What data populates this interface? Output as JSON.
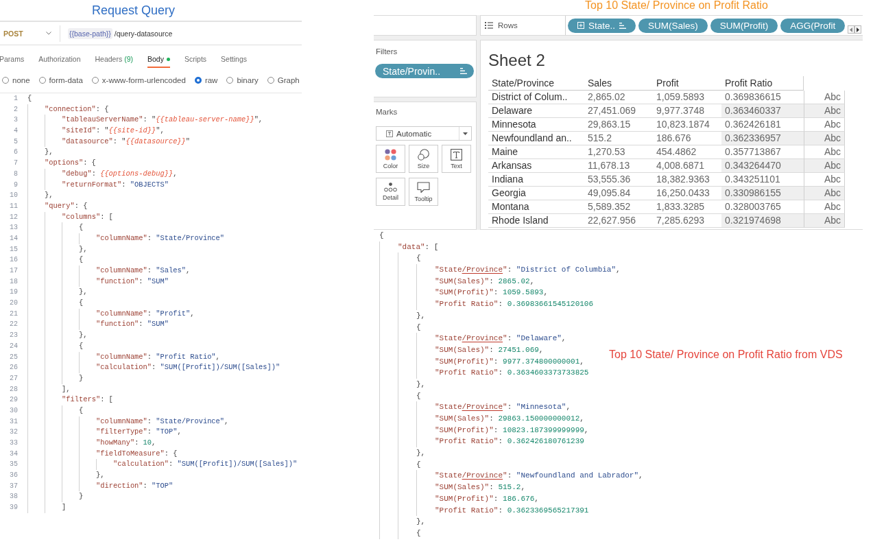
{
  "request": {
    "title": "Request Query",
    "method": "POST",
    "url": {
      "variable": "{{base-path}}",
      "path": "/query-datasource"
    },
    "tabs": [
      {
        "label": "Params",
        "selected": false,
        "has_content": false
      },
      {
        "label": "Authorization",
        "selected": false,
        "has_content": false
      },
      {
        "label": "Headers",
        "count": "(9)",
        "selected": false,
        "has_content": false
      },
      {
        "label": "Body",
        "selected": true,
        "has_content": true
      },
      {
        "label": "Scripts",
        "selected": false,
        "has_content": false
      },
      {
        "label": "Settings",
        "selected": false,
        "has_content": false
      }
    ],
    "body_types": [
      {
        "label": "none",
        "selected": false
      },
      {
        "label": "form-data",
        "selected": false
      },
      {
        "label": "x-www-form-urlencoded",
        "selected": false
      },
      {
        "label": "raw",
        "selected": true
      },
      {
        "label": "binary",
        "selected": false
      },
      {
        "label": "Graph",
        "selected": false
      }
    ],
    "editor": {
      "lines": [
        {
          "number": "1",
          "tokens": [
            {
              "kind": "punct",
              "text": "{"
            }
          ],
          "children": [
            {
              "number": "2",
              "tokens": [
                {
                  "kind": "key",
                  "text": "\"connection\""
                },
                {
                  "kind": "punct",
                  "text": ": {"
                }
              ],
              "children": [
                {
                  "number": "3",
                  "tokens": [
                    {
                      "kind": "key",
                      "text": "\"tableauServerName\""
                    },
                    {
                      "kind": "punct",
                      "text": ": \""
                    },
                    {
                      "kind": "var",
                      "text": "{{tableau-server-name}}"
                    },
                    {
                      "kind": "punct",
                      "text": "\","
                    }
                  ]
                },
                {
                  "number": "4",
                  "tokens": [
                    {
                      "kind": "key",
                      "text": "\"siteId\""
                    },
                    {
                      "kind": "punct",
                      "text": ": \""
                    },
                    {
                      "kind": "var",
                      "text": "{{site-id}}"
                    },
                    {
                      "kind": "punct",
                      "text": "\","
                    }
                  ]
                },
                {
                  "number": "5",
                  "tokens": [
                    {
                      "kind": "key",
                      "text": "\"datasource\""
                    },
                    {
                      "kind": "punct",
                      "text": ": \""
                    },
                    {
                      "kind": "var",
                      "text": "{{datasource}}"
                    },
                    {
                      "kind": "punct",
                      "text": "\""
                    }
                  ]
                }
              ]
            },
            {
              "number": "6",
              "tokens": [
                {
                  "kind": "punct",
                  "text": "},"
                }
              ]
            },
            {
              "number": "7",
              "tokens": [
                {
                  "kind": "key",
                  "text": "\"options\""
                },
                {
                  "kind": "punct",
                  "text": ": {"
                }
              ],
              "children": [
                {
                  "number": "8",
                  "tokens": [
                    {
                      "kind": "key",
                      "text": "\"debug\""
                    },
                    {
                      "kind": "punct",
                      "text": ": "
                    },
                    {
                      "kind": "var",
                      "text": "{{options-debug}}"
                    },
                    {
                      "kind": "punct",
                      "text": ","
                    }
                  ]
                },
                {
                  "number": "9",
                  "tokens": [
                    {
                      "kind": "key",
                      "text": "\"returnFormat\""
                    },
                    {
                      "kind": "punct",
                      "text": ": "
                    },
                    {
                      "kind": "string",
                      "text": "\"OBJECTS\""
                    }
                  ]
                }
              ]
            },
            {
              "number": "10",
              "tokens": [
                {
                  "kind": "punct",
                  "text": "},"
                }
              ]
            },
            {
              "number": "11",
              "tokens": [
                {
                  "kind": "key",
                  "text": "\"query\""
                },
                {
                  "kind": "punct",
                  "text": ": {"
                }
              ],
              "children": [
                {
                  "number": "12",
                  "tokens": [
                    {
                      "kind": "key",
                      "text": "\"columns\""
                    },
                    {
                      "kind": "punct",
                      "text": ": ["
                    }
                  ],
                  "children": [
                    {
                      "number": "13",
                      "tokens": [
                        {
                          "kind": "punct",
                          "text": "{"
                        }
                      ],
                      "children": [
                        {
                          "number": "14",
                          "tokens": [
                            {
                              "kind": "key",
                              "text": "\"columnName\""
                            },
                            {
                              "kind": "punct",
                              "text": ": "
                            },
                            {
                              "kind": "string",
                              "text": "\"State/Province\""
                            }
                          ]
                        }
                      ]
                    },
                    {
                      "number": "15",
                      "tokens": [
                        {
                          "kind": "punct",
                          "text": "},"
                        }
                      ]
                    },
                    {
                      "number": "16",
                      "tokens": [
                        {
                          "kind": "punct",
                          "text": "{"
                        }
                      ],
                      "children": [
                        {
                          "number": "17",
                          "tokens": [
                            {
                              "kind": "key",
                              "text": "\"columnName\""
                            },
                            {
                              "kind": "punct",
                              "text": ": "
                            },
                            {
                              "kind": "string",
                              "text": "\"Sales\""
                            },
                            {
                              "kind": "punct",
                              "text": ","
                            }
                          ]
                        },
                        {
                          "number": "18",
                          "tokens": [
                            {
                              "kind": "key",
                              "text": "\"function\""
                            },
                            {
                              "kind": "punct",
                              "text": ": "
                            },
                            {
                              "kind": "string",
                              "text": "\"SUM\""
                            }
                          ]
                        }
                      ]
                    },
                    {
                      "number": "19",
                      "tokens": [
                        {
                          "kind": "punct",
                          "text": "},"
                        }
                      ]
                    },
                    {
                      "number": "20",
                      "tokens": [
                        {
                          "kind": "punct",
                          "text": "{"
                        }
                      ],
                      "children": [
                        {
                          "number": "21",
                          "tokens": [
                            {
                              "kind": "key",
                              "text": "\"columnName\""
                            },
                            {
                              "kind": "punct",
                              "text": ": "
                            },
                            {
                              "kind": "string",
                              "text": "\"Profit\""
                            },
                            {
                              "kind": "punct",
                              "text": ","
                            }
                          ]
                        },
                        {
                          "number": "22",
                          "tokens": [
                            {
                              "kind": "key",
                              "text": "\"function\""
                            },
                            {
                              "kind": "punct",
                              "text": ": "
                            },
                            {
                              "kind": "string",
                              "text": "\"SUM\""
                            }
                          ]
                        }
                      ]
                    },
                    {
                      "number": "23",
                      "tokens": [
                        {
                          "kind": "punct",
                          "text": "},"
                        }
                      ]
                    },
                    {
                      "number": "24",
                      "tokens": [
                        {
                          "kind": "punct",
                          "text": "{"
                        }
                      ],
                      "children": [
                        {
                          "number": "25",
                          "tokens": [
                            {
                              "kind": "key",
                              "text": "\"columnName\""
                            },
                            {
                              "kind": "punct",
                              "text": ": "
                            },
                            {
                              "kind": "string",
                              "text": "\"Profit Ratio\""
                            },
                            {
                              "kind": "punct",
                              "text": ","
                            }
                          ]
                        },
                        {
                          "number": "26",
                          "tokens": [
                            {
                              "kind": "key",
                              "text": "\"calculation\""
                            },
                            {
                              "kind": "punct",
                              "text": ": "
                            },
                            {
                              "kind": "string",
                              "text": "\"SUM([Profit])/SUM([Sales])\""
                            }
                          ]
                        }
                      ]
                    },
                    {
                      "number": "27",
                      "tokens": [
                        {
                          "kind": "punct",
                          "text": "}"
                        }
                      ]
                    }
                  ]
                },
                {
                  "number": "28",
                  "tokens": [
                    {
                      "kind": "punct",
                      "text": "],"
                    }
                  ]
                },
                {
                  "number": "29",
                  "tokens": [
                    {
                      "kind": "key",
                      "text": "\"filters\""
                    },
                    {
                      "kind": "punct",
                      "text": ": ["
                    }
                  ],
                  "children": [
                    {
                      "number": "30",
                      "tokens": [
                        {
                          "kind": "punct",
                          "text": "{"
                        }
                      ],
                      "children": [
                        {
                          "number": "31",
                          "tokens": [
                            {
                              "kind": "key",
                              "text": "\"columnName\""
                            },
                            {
                              "kind": "punct",
                              "text": ": "
                            },
                            {
                              "kind": "string",
                              "text": "\"State/Province\""
                            },
                            {
                              "kind": "punct",
                              "text": ","
                            }
                          ]
                        },
                        {
                          "number": "32",
                          "tokens": [
                            {
                              "kind": "key",
                              "text": "\"filterType\""
                            },
                            {
                              "kind": "punct",
                              "text": ": "
                            },
                            {
                              "kind": "string",
                              "text": "\"TOP\""
                            },
                            {
                              "kind": "punct",
                              "text": ","
                            }
                          ]
                        },
                        {
                          "number": "33",
                          "tokens": [
                            {
                              "kind": "key",
                              "text": "\"howMany\""
                            },
                            {
                              "kind": "punct",
                              "text": ": "
                            },
                            {
                              "kind": "number",
                              "text": "10"
                            },
                            {
                              "kind": "punct",
                              "text": ","
                            }
                          ]
                        },
                        {
                          "number": "34",
                          "tokens": [
                            {
                              "kind": "key",
                              "text": "\"fieldToMeasure\""
                            },
                            {
                              "kind": "punct",
                              "text": ": {"
                            }
                          ],
                          "children": [
                            {
                              "number": "35",
                              "tokens": [
                                {
                                  "kind": "key",
                                  "text": "\"calculation\""
                                },
                                {
                                  "kind": "punct",
                                  "text": ": "
                                },
                                {
                                  "kind": "string",
                                  "text": "\"SUM([Profit])/SUM([Sales])\""
                                }
                              ]
                            }
                          ]
                        },
                        {
                          "number": "36",
                          "tokens": [
                            {
                              "kind": "punct",
                              "text": "},"
                            }
                          ]
                        },
                        {
                          "number": "37",
                          "tokens": [
                            {
                              "kind": "key",
                              "text": "\"direction\""
                            },
                            {
                              "kind": "punct",
                              "text": ": "
                            },
                            {
                              "kind": "string",
                              "text": "\"TOP\""
                            }
                          ]
                        }
                      ]
                    },
                    {
                      "number": "38",
                      "tokens": [
                        {
                          "kind": "punct",
                          "text": "}"
                        }
                      ]
                    }
                  ]
                },
                {
                  "number": "39",
                  "tokens": [
                    {
                      "kind": "punct",
                      "text": "]"
                    }
                  ]
                }
              ]
            }
          ]
        }
      ]
    }
  },
  "tableau": {
    "title": "Top 10 State/ Province on Profit Ratio",
    "rows_shelf": {
      "label": "Rows",
      "pills": [
        {
          "label": "State..",
          "hierarchy": true,
          "sorted": true
        },
        {
          "label": "SUM(Sales)",
          "hierarchy": false,
          "sorted": false
        },
        {
          "label": "SUM(Profit)",
          "hierarchy": false,
          "sorted": false
        },
        {
          "label": "AGG(Profit",
          "hierarchy": false,
          "sorted": false
        }
      ]
    },
    "filters": {
      "title": "Filters",
      "pills": [
        {
          "label": "State/Provin..",
          "hierarchy": false,
          "sorted": true
        }
      ]
    },
    "marks": {
      "title": "Marks",
      "mark_type": "Automatic",
      "cards": [
        {
          "label": "Color",
          "kind": "color"
        },
        {
          "label": "Size",
          "kind": "size"
        },
        {
          "label": "Text",
          "kind": "text"
        },
        {
          "label": "Detail",
          "kind": "detail"
        },
        {
          "label": "Tooltip",
          "kind": "tooltip"
        }
      ]
    },
    "sheet": {
      "title": "Sheet 2",
      "columns": [
        "State/Province",
        "Sales",
        "Profit",
        "Profit Ratio"
      ],
      "rows": [
        [
          "District of Colum..",
          "2,865.02",
          "1,059.5893",
          "0.369836615",
          "Abc"
        ],
        [
          "Delaware",
          "27,451.069",
          "9,977.3748",
          "0.363460337",
          "Abc"
        ],
        [
          "Minnesota",
          "29,863.15",
          "10,823.1874",
          "0.362426181",
          "Abc"
        ],
        [
          "Newfoundland an..",
          "515.2",
          "186.676",
          "0.362336957",
          "Abc"
        ],
        [
          "Maine",
          "1,270.53",
          "454.4862",
          "0.357713867",
          "Abc"
        ],
        [
          "Arkansas",
          "11,678.13",
          "4,008.6871",
          "0.343264470",
          "Abc"
        ],
        [
          "Indiana",
          "53,555.36",
          "18,382.9363",
          "0.343251101",
          "Abc"
        ],
        [
          "Georgia",
          "49,095.84",
          "16,250.0433",
          "0.330986155",
          "Abc"
        ],
        [
          "Montana",
          "5,589.352",
          "1,833.3285",
          "0.328003765",
          "Abc"
        ],
        [
          "Rhode Island",
          "22,627.956",
          "7,285.6293",
          "0.321974698",
          "Abc"
        ]
      ]
    }
  },
  "response": {
    "annotation": "Top 10 State/ Province on Profit Ratio from VDS",
    "lines": [
      {
        "tokens": [
          {
            "kind": "punct",
            "text": "{"
          }
        ],
        "children": [
          {
            "tokens": [
              {
                "kind": "key",
                "text": "\"data\""
              },
              {
                "kind": "punct",
                "text": ": ["
              }
            ],
            "children": [
              {
                "tokens": [
                  {
                    "kind": "punct",
                    "text": "{"
                  }
                ],
                "children": [
                  {
                    "tokens": [
                      {
                        "kind": "key",
                        "text": "\"State"
                      },
                      {
                        "kind": "flagged",
                        "text": "/Province"
                      },
                      {
                        "kind": "key",
                        "text": "\""
                      },
                      {
                        "kind": "punct",
                        "text": ": "
                      },
                      {
                        "kind": "string",
                        "text": "\"District of Columbia\""
                      },
                      {
                        "kind": "punct",
                        "text": ","
                      }
                    ]
                  },
                  {
                    "tokens": [
                      {
                        "kind": "key",
                        "text": "\"SUM(Sales)\""
                      },
                      {
                        "kind": "punct",
                        "text": ": "
                      },
                      {
                        "kind": "number",
                        "text": "2865.02"
                      },
                      {
                        "kind": "punct",
                        "text": ","
                      }
                    ]
                  },
                  {
                    "tokens": [
                      {
                        "kind": "key",
                        "text": "\"SUM(Profit)\""
                      },
                      {
                        "kind": "punct",
                        "text": ": "
                      },
                      {
                        "kind": "number",
                        "text": "1059.5893"
                      },
                      {
                        "kind": "punct",
                        "text": ","
                      }
                    ]
                  },
                  {
                    "tokens": [
                      {
                        "kind": "key",
                        "text": "\"Profit Ratio\""
                      },
                      {
                        "kind": "punct",
                        "text": ": "
                      },
                      {
                        "kind": "number",
                        "text": "0.36983661545120106"
                      }
                    ]
                  }
                ]
              },
              {
                "tokens": [
                  {
                    "kind": "punct",
                    "text": "},"
                  }
                ]
              },
              {
                "tokens": [
                  {
                    "kind": "punct",
                    "text": "{"
                  }
                ],
                "children": [
                  {
                    "tokens": [
                      {
                        "kind": "key",
                        "text": "\"State"
                      },
                      {
                        "kind": "flagged",
                        "text": "/Province"
                      },
                      {
                        "kind": "key",
                        "text": "\""
                      },
                      {
                        "kind": "punct",
                        "text": ": "
                      },
                      {
                        "kind": "string",
                        "text": "\"Delaware\""
                      },
                      {
                        "kind": "punct",
                        "text": ","
                      }
                    ]
                  },
                  {
                    "tokens": [
                      {
                        "kind": "key",
                        "text": "\"SUM(Sales)\""
                      },
                      {
                        "kind": "punct",
                        "text": ": "
                      },
                      {
                        "kind": "number",
                        "text": "27451.069"
                      },
                      {
                        "kind": "punct",
                        "text": ","
                      }
                    ]
                  },
                  {
                    "tokens": [
                      {
                        "kind": "key",
                        "text": "\"SUM(Profit)\""
                      },
                      {
                        "kind": "punct",
                        "text": ": "
                      },
                      {
                        "kind": "number",
                        "text": "9977.374800000001"
                      },
                      {
                        "kind": "punct",
                        "text": ","
                      }
                    ]
                  },
                  {
                    "tokens": [
                      {
                        "kind": "key",
                        "text": "\"Profit Ratio\""
                      },
                      {
                        "kind": "punct",
                        "text": ": "
                      },
                      {
                        "kind": "number",
                        "text": "0.3634603373733825"
                      }
                    ]
                  }
                ]
              },
              {
                "tokens": [
                  {
                    "kind": "punct",
                    "text": "},"
                  }
                ]
              },
              {
                "tokens": [
                  {
                    "kind": "punct",
                    "text": "{"
                  }
                ],
                "children": [
                  {
                    "tokens": [
                      {
                        "kind": "key",
                        "text": "\"State"
                      },
                      {
                        "kind": "flagged",
                        "text": "/Province"
                      },
                      {
                        "kind": "key",
                        "text": "\""
                      },
                      {
                        "kind": "punct",
                        "text": ": "
                      },
                      {
                        "kind": "string",
                        "text": "\"Minnesota\""
                      },
                      {
                        "kind": "punct",
                        "text": ","
                      }
                    ]
                  },
                  {
                    "tokens": [
                      {
                        "kind": "key",
                        "text": "\"SUM(Sales)\""
                      },
                      {
                        "kind": "punct",
                        "text": ": "
                      },
                      {
                        "kind": "number",
                        "text": "29863.150000000012"
                      },
                      {
                        "kind": "punct",
                        "text": ","
                      }
                    ]
                  },
                  {
                    "tokens": [
                      {
                        "kind": "key",
                        "text": "\"SUM(Profit)\""
                      },
                      {
                        "kind": "punct",
                        "text": ": "
                      },
                      {
                        "kind": "number",
                        "text": "10823.187399999999"
                      },
                      {
                        "kind": "punct",
                        "text": ","
                      }
                    ]
                  },
                  {
                    "tokens": [
                      {
                        "kind": "key",
                        "text": "\"Profit Ratio\""
                      },
                      {
                        "kind": "punct",
                        "text": ": "
                      },
                      {
                        "kind": "number",
                        "text": "0.362426180761239"
                      }
                    ]
                  }
                ]
              },
              {
                "tokens": [
                  {
                    "kind": "punct",
                    "text": "},"
                  }
                ]
              },
              {
                "tokens": [
                  {
                    "kind": "punct",
                    "text": "{"
                  }
                ],
                "children": [
                  {
                    "tokens": [
                      {
                        "kind": "key",
                        "text": "\"State"
                      },
                      {
                        "kind": "flagged",
                        "text": "/Province"
                      },
                      {
                        "kind": "key",
                        "text": "\""
                      },
                      {
                        "kind": "punct",
                        "text": ": "
                      },
                      {
                        "kind": "string",
                        "text": "\"Newfoundland and Labrador\""
                      },
                      {
                        "kind": "punct",
                        "text": ","
                      }
                    ]
                  },
                  {
                    "tokens": [
                      {
                        "kind": "key",
                        "text": "\"SUM(Sales)\""
                      },
                      {
                        "kind": "punct",
                        "text": ": "
                      },
                      {
                        "kind": "number",
                        "text": "515.2"
                      },
                      {
                        "kind": "punct",
                        "text": ","
                      }
                    ]
                  },
                  {
                    "tokens": [
                      {
                        "kind": "key",
                        "text": "\"SUM(Profit)\""
                      },
                      {
                        "kind": "punct",
                        "text": ": "
                      },
                      {
                        "kind": "number",
                        "text": "186.676"
                      },
                      {
                        "kind": "punct",
                        "text": ","
                      }
                    ]
                  },
                  {
                    "tokens": [
                      {
                        "kind": "key",
                        "text": "\"Profit Ratio\""
                      },
                      {
                        "kind": "punct",
                        "text": ": "
                      },
                      {
                        "kind": "number",
                        "text": "0.3623369565217391"
                      }
                    ]
                  }
                ]
              },
              {
                "tokens": [
                  {
                    "kind": "punct",
                    "text": "},"
                  }
                ]
              },
              {
                "tokens": [
                  {
                    "kind": "punct",
                    "text": "{"
                  }
                ]
              }
            ]
          }
        ]
      }
    ]
  }
}
